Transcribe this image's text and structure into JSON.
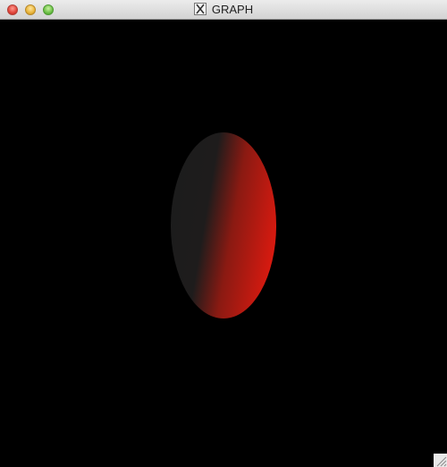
{
  "window": {
    "title": "GRAPH",
    "title_icon": "x11-icon"
  },
  "scene": {
    "object": "shaded-ellipsoid",
    "colors": {
      "lit": "#dd1a10",
      "mid": "#8a1a12",
      "shadow": "#1c1c1c",
      "background": "#000000"
    }
  }
}
